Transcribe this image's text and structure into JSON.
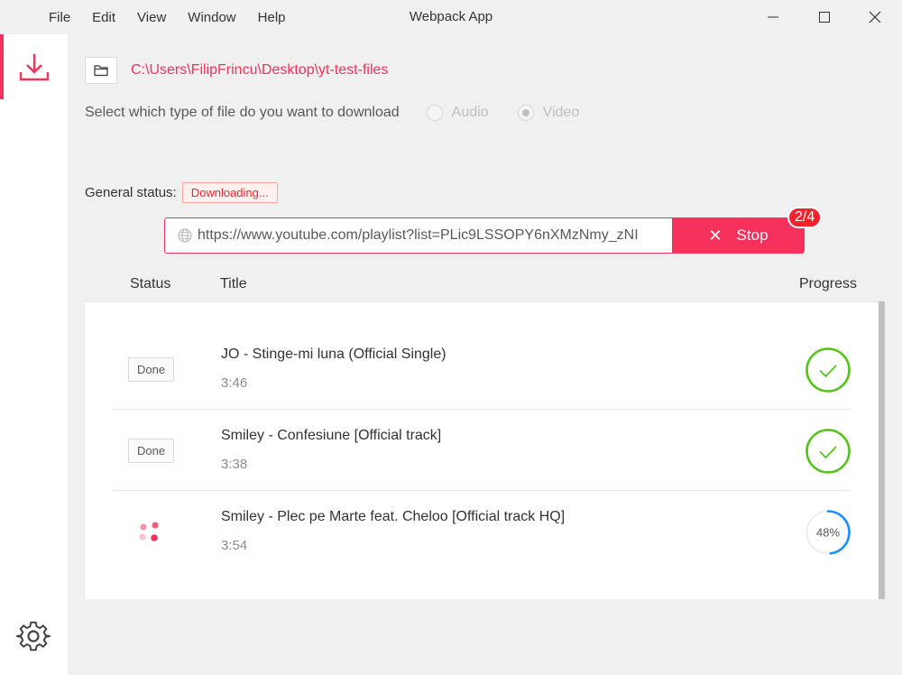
{
  "window": {
    "title": "Webpack App",
    "menu": [
      "File",
      "Edit",
      "View",
      "Window",
      "Help"
    ]
  },
  "sidebar": {
    "items": [
      {
        "icon": "download-icon",
        "active": true
      },
      {
        "icon": "gear-icon",
        "active": false
      }
    ]
  },
  "toolbar": {
    "download_path": "C:\\Users\\FilipFrincu\\Desktop\\yt-test-files",
    "filetype_prompt": "Select which type of file do you want to download",
    "filetype_options": [
      {
        "label": "Audio",
        "selected": false
      },
      {
        "label": "Video",
        "selected": true
      }
    ]
  },
  "status": {
    "label": "General status:",
    "value": "Downloading..."
  },
  "url_input": {
    "value": "https://www.youtube.com/playlist?list=PLic9LSSOPY6nXMzNmy_zNI"
  },
  "stop_button": {
    "label": "Stop",
    "badge": "2/4"
  },
  "table": {
    "columns": [
      "Status",
      "Title",
      "Progress"
    ],
    "rows": [
      {
        "status": "Done",
        "title": "JO - Stinge-mi luna (Official Single)",
        "duration": "3:46",
        "progress_state": "complete"
      },
      {
        "status": "Done",
        "title": "Smiley - Confesiune [Official track]",
        "duration": "3:38",
        "progress_state": "complete"
      },
      {
        "status": "loading",
        "title": "Smiley - Plec pe Marte feat. Cheloo [Official track HQ]",
        "duration": "3:54",
        "progress_state": "in-progress",
        "progress_percent": 48,
        "progress_label": "48%"
      }
    ]
  },
  "colors": {
    "accent": "#f5315c",
    "success": "#52c41a",
    "progress": "#1890ff"
  }
}
